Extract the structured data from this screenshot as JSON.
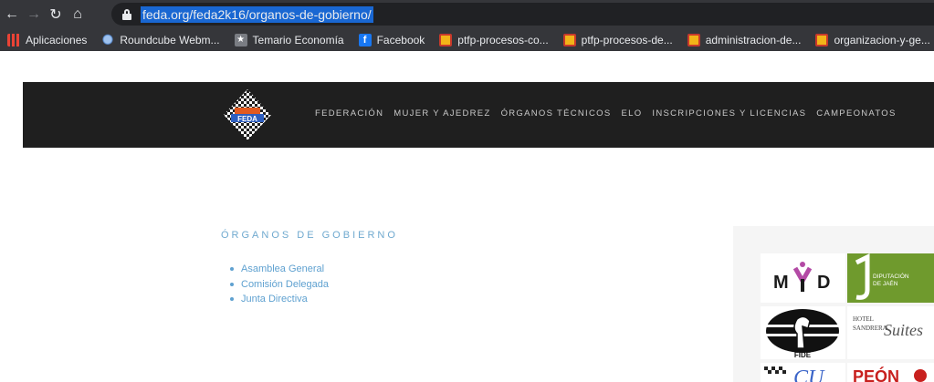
{
  "browser": {
    "url": "feda.org/feda2k16/organos-de-gobierno/",
    "bookmarks": [
      {
        "label": "Aplicaciones",
        "icon": "apps-grid-icon"
      },
      {
        "label": "Roundcube Webm...",
        "icon": "roundcube-icon"
      },
      {
        "label": "Temario Economía",
        "icon": "star-icon"
      },
      {
        "label": "Facebook",
        "icon": "facebook-icon"
      },
      {
        "label": "ptfp-procesos-co...",
        "icon": "spain-gov-icon"
      },
      {
        "label": "ptfp-procesos-de...",
        "icon": "spain-gov-icon"
      },
      {
        "label": "administracion-de...",
        "icon": "spain-gov-icon"
      },
      {
        "label": "organizacion-y-ge...",
        "icon": "spain-gov-icon"
      }
    ]
  },
  "site": {
    "logo_text": "FEDA",
    "nav": [
      "FEDERACIÓN",
      "MUJER Y AJEDREZ",
      "ÓRGANOS TÉCNICOS",
      "ELO",
      "INSCRIPCIONES Y LICENCIAS",
      "CAMPEONATOS"
    ]
  },
  "content": {
    "title": "ÓRGANOS DE GOBIERNO",
    "links": [
      "Asamblea General",
      "Comisión Delegada",
      "Junta Directiva"
    ]
  },
  "sidebar": {
    "sponsors": {
      "mvd": "MYD",
      "diputacion": "DIPUTACIÓN DE JAÉN",
      "fide": "FIDE",
      "hotel_line1": "HOTEL",
      "hotel_line2": "SANDRERA",
      "hotel_line3": "Suites",
      "cu": "CU",
      "peon": "PEÓN"
    }
  }
}
